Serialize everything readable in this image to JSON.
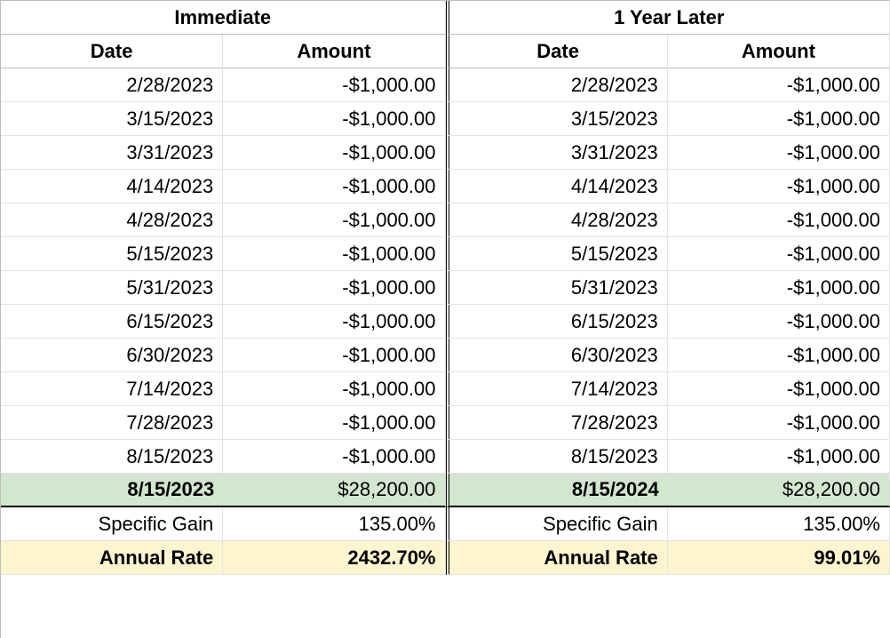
{
  "left": {
    "title": "Immediate",
    "headers": {
      "date": "Date",
      "amount": "Amount"
    },
    "rows": [
      {
        "date": "2/28/2023",
        "amount": "-$1,000.00"
      },
      {
        "date": "3/15/2023",
        "amount": "-$1,000.00"
      },
      {
        "date": "3/31/2023",
        "amount": "-$1,000.00"
      },
      {
        "date": "4/14/2023",
        "amount": "-$1,000.00"
      },
      {
        "date": "4/28/2023",
        "amount": "-$1,000.00"
      },
      {
        "date": "5/15/2023",
        "amount": "-$1,000.00"
      },
      {
        "date": "5/31/2023",
        "amount": "-$1,000.00"
      },
      {
        "date": "6/15/2023",
        "amount": "-$1,000.00"
      },
      {
        "date": "6/30/2023",
        "amount": "-$1,000.00"
      },
      {
        "date": "7/14/2023",
        "amount": "-$1,000.00"
      },
      {
        "date": "7/28/2023",
        "amount": "-$1,000.00"
      },
      {
        "date": "8/15/2023",
        "amount": "-$1,000.00"
      }
    ],
    "payout": {
      "date": "8/15/2023",
      "amount": "$28,200.00"
    },
    "specific_gain": {
      "label": "Specific Gain",
      "value": "135.00%"
    },
    "annual_rate": {
      "label": "Annual Rate",
      "value": "2432.70%"
    }
  },
  "right": {
    "title": "1 Year Later",
    "headers": {
      "date": "Date",
      "amount": "Amount"
    },
    "rows": [
      {
        "date": "2/28/2023",
        "amount": "-$1,000.00"
      },
      {
        "date": "3/15/2023",
        "amount": "-$1,000.00"
      },
      {
        "date": "3/31/2023",
        "amount": "-$1,000.00"
      },
      {
        "date": "4/14/2023",
        "amount": "-$1,000.00"
      },
      {
        "date": "4/28/2023",
        "amount": "-$1,000.00"
      },
      {
        "date": "5/15/2023",
        "amount": "-$1,000.00"
      },
      {
        "date": "5/31/2023",
        "amount": "-$1,000.00"
      },
      {
        "date": "6/15/2023",
        "amount": "-$1,000.00"
      },
      {
        "date": "6/30/2023",
        "amount": "-$1,000.00"
      },
      {
        "date": "7/14/2023",
        "amount": "-$1,000.00"
      },
      {
        "date": "7/28/2023",
        "amount": "-$1,000.00"
      },
      {
        "date": "8/15/2023",
        "amount": "-$1,000.00"
      }
    ],
    "payout": {
      "date": "8/15/2024",
      "amount": "$28,200.00"
    },
    "specific_gain": {
      "label": "Specific Gain",
      "value": "135.00%"
    },
    "annual_rate": {
      "label": "Annual Rate",
      "value": "99.01%"
    }
  }
}
